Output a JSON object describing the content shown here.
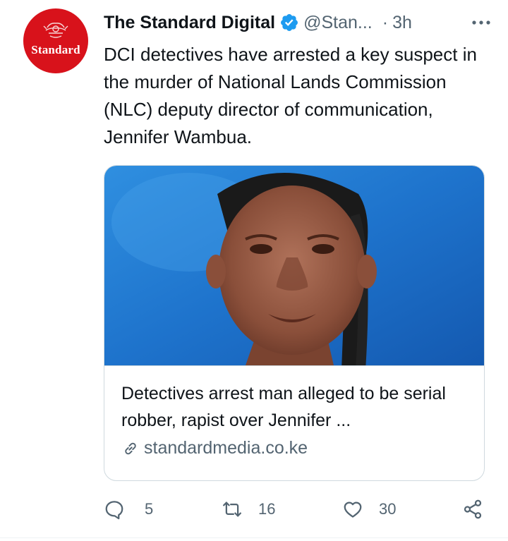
{
  "tweet": {
    "avatar_text": "Standard",
    "display_name": "The Standard Digital",
    "handle": "@Stan...",
    "separator": "·",
    "time": "3h",
    "text": "DCI detectives have arrested a key suspect in the murder of National Lands Commission (NLC) deputy director of communication, Jennifer Wambua.",
    "verified_icon": "verified-badge-icon",
    "more_icon": "more-icon"
  },
  "card": {
    "title": "Detectives arrest man alleged to be serial robber, rapist over Jennifer ...",
    "domain": "standardmedia.co.ke",
    "link_icon": "link-icon"
  },
  "actions": {
    "reply_count": "5",
    "retweet_count": "16",
    "like_count": "30",
    "icons": [
      "reply-icon",
      "retweet-icon",
      "like-icon",
      "share-icon"
    ]
  },
  "colors": {
    "brand_red": "#d8121b",
    "verified_blue": "#1d9bf0",
    "text_primary": "#0f1419",
    "text_secondary": "#536471",
    "border": "#cfd9de"
  }
}
